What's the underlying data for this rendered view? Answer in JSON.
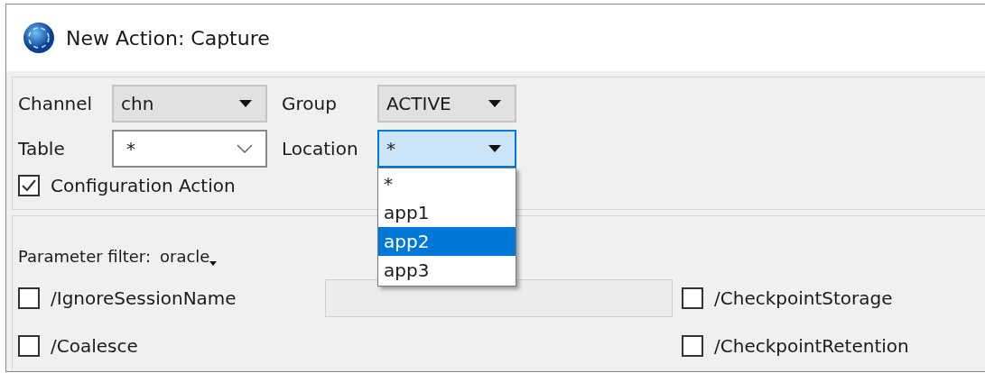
{
  "window": {
    "title": "New Action: Capture"
  },
  "fields": [
    {
      "label": "Channel",
      "value": "chn",
      "kind": "combo",
      "focused": false
    },
    {
      "label": "Group",
      "value": "ACTIVE",
      "kind": "combo",
      "focused": false
    },
    {
      "label": "Table",
      "value": "*",
      "kind": "editable",
      "focused": false
    },
    {
      "label": "Location",
      "value": "*",
      "kind": "combo",
      "focused": true
    }
  ],
  "dropdown": {
    "items": [
      {
        "label": "*",
        "selected": false
      },
      {
        "label": "app1",
        "selected": false
      },
      {
        "label": "app2",
        "selected": true
      },
      {
        "label": "app3",
        "selected": false
      }
    ]
  },
  "configuration_action": {
    "label": "Configuration Action",
    "checked": true
  },
  "parameter_filter": {
    "label": "Parameter filter:",
    "value": "oracle"
  },
  "parameters": [
    {
      "label": "/IgnoreSessionName",
      "checked": false
    },
    {
      "label": "/CheckpointStorage",
      "checked": false
    },
    {
      "label": "/Coalesce",
      "checked": false
    },
    {
      "label": "/CheckpointRetention",
      "checked": false
    }
  ]
}
